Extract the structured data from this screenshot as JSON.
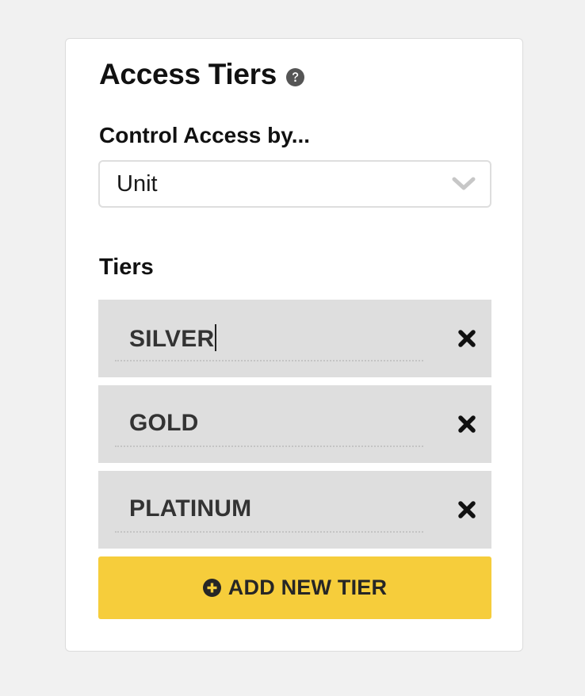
{
  "panel": {
    "title": "Access Tiers",
    "help_icon": "question-circle-icon"
  },
  "control_access": {
    "label": "Control Access by...",
    "selected_value": "Unit",
    "dropdown_icon": "chevron-down-icon"
  },
  "tiers": {
    "label": "Tiers",
    "items": [
      {
        "name": "SILVER",
        "focused": true
      },
      {
        "name": "GOLD",
        "focused": false
      },
      {
        "name": "PLATINUM",
        "focused": false
      }
    ],
    "remove_icon": "close-x-icon"
  },
  "add_button": {
    "label": "ADD NEW TIER",
    "icon": "plus-circle-icon",
    "color": "#f6cd3b"
  },
  "colors": {
    "background": "#f1f1f1",
    "panel": "#ffffff",
    "tier_row": "#dedede",
    "accent": "#f6cd3b"
  }
}
